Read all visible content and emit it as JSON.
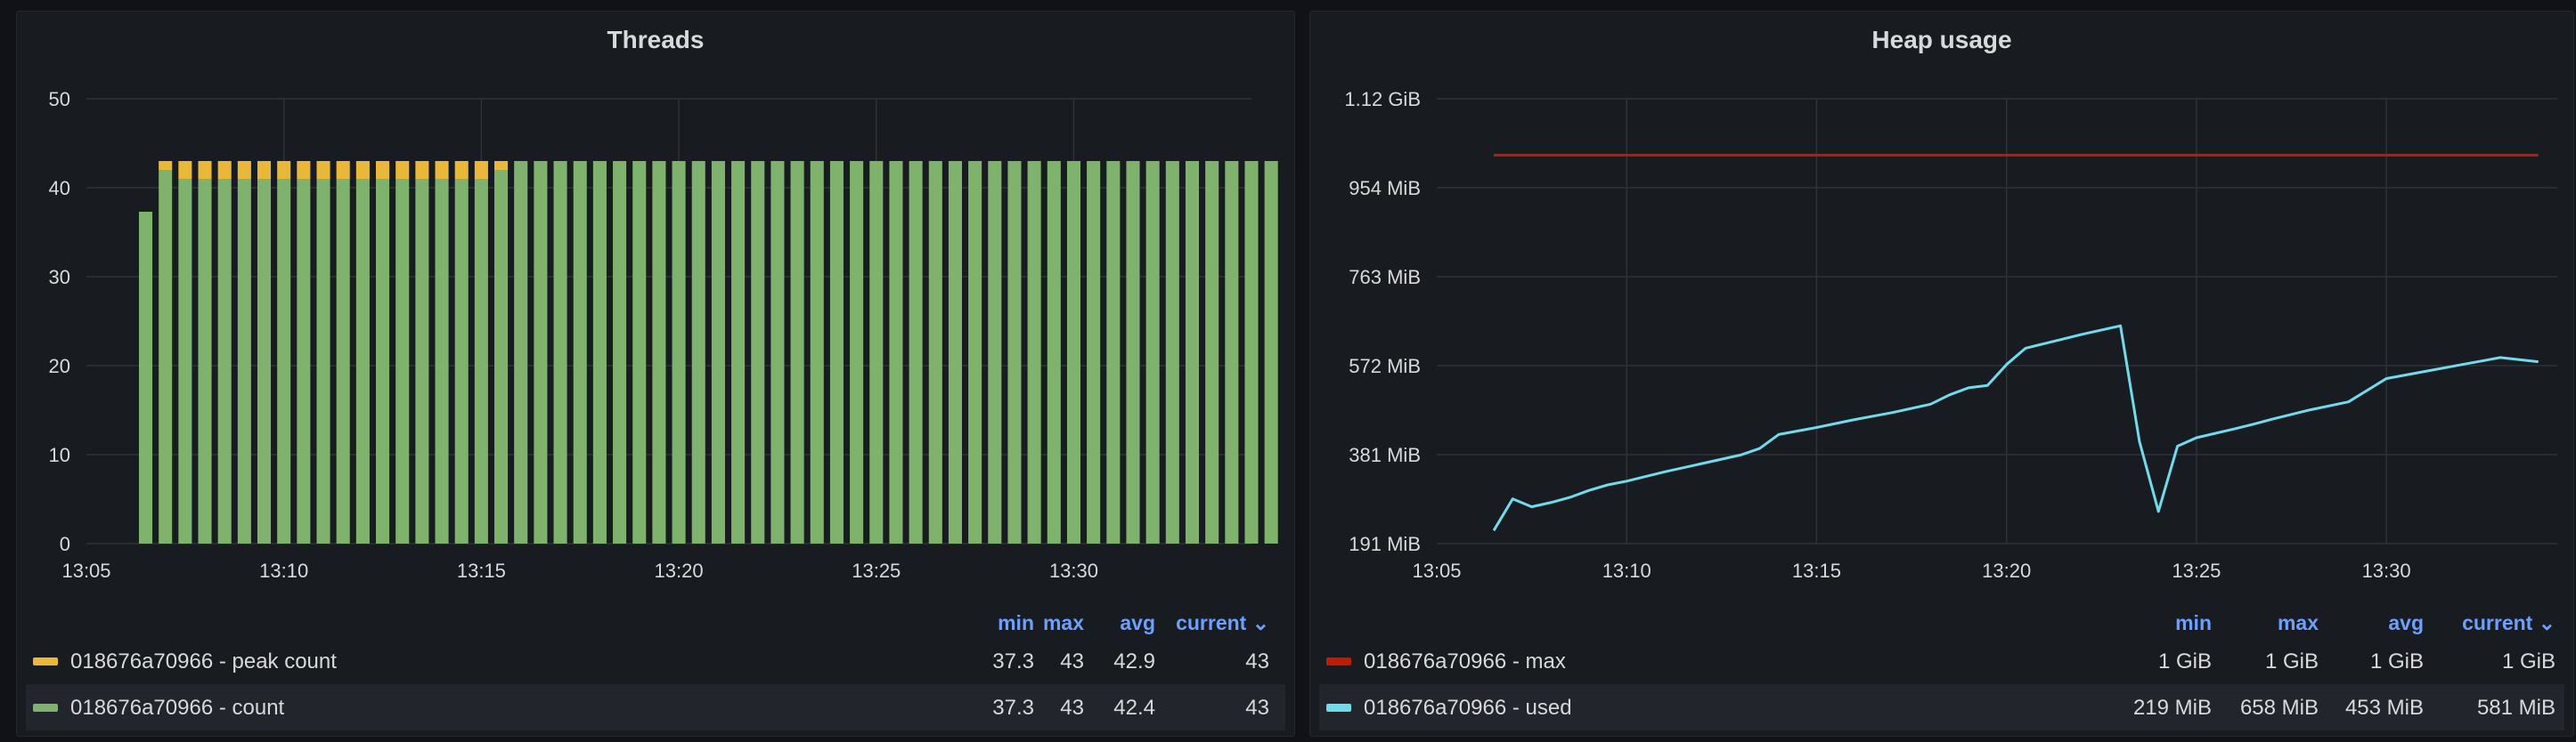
{
  "colors": {
    "peak": "#eab839",
    "count": "#7eb26d",
    "max": "#bf1b00",
    "used": "#70dbed",
    "grid": "#2f3237",
    "tick": "#d8d9da",
    "header": "#6e9fff"
  },
  "panels": [
    {
      "title": "Threads",
      "legend": {
        "headers": {
          "min": "min",
          "max": "max",
          "avg": "avg",
          "current": "current ⌄"
        },
        "rows": [
          {
            "name": "018676a70966 - peak count",
            "min": "37.3",
            "max": "43",
            "avg": "42.9",
            "current": "43",
            "color_key": "peak"
          },
          {
            "name": "018676a70966 - count",
            "min": "37.3",
            "max": "43",
            "avg": "42.4",
            "current": "43",
            "color_key": "count"
          }
        ]
      }
    },
    {
      "title": "Heap usage",
      "legend": {
        "headers": {
          "min": "min",
          "max": "max",
          "avg": "avg",
          "current": "current ⌄"
        },
        "rows": [
          {
            "name": "018676a70966 - max",
            "min": "1 GiB",
            "max": "1 GiB",
            "avg": "1 GiB",
            "current": "1 GiB",
            "color_key": "max"
          },
          {
            "name": "018676a70966 - used",
            "min": "219 MiB",
            "max": "658 MiB",
            "avg": "453 MiB",
            "current": "581 MiB",
            "color_key": "used"
          }
        ]
      }
    }
  ],
  "chart_data": [
    {
      "type": "bar",
      "title": "Threads",
      "stacked": true,
      "x_ticks": [
        "13:05",
        "13:10",
        "13:15",
        "13:20",
        "13:25",
        "13:30"
      ],
      "y_ticks": [
        "0",
        "10",
        "20",
        "30",
        "40",
        "50"
      ],
      "ylim": [
        0,
        50
      ],
      "x_range_minutes": [
        0,
        29.5
      ],
      "grid": true,
      "legend_position": "bottom",
      "bar_start_minute": 1.5,
      "bar_step_minutes": 0.5,
      "series": [
        {
          "name": "018676a70966 - count",
          "color_key": "count",
          "values": [
            37.3,
            42,
            41,
            41,
            41,
            41,
            41,
            41,
            41,
            41,
            41,
            41,
            41,
            41,
            41,
            41,
            41,
            41,
            42,
            43,
            43,
            43,
            43,
            43,
            43,
            43,
            43,
            43,
            43,
            43,
            43,
            43,
            43,
            43,
            43,
            43,
            43,
            43,
            43,
            43,
            43,
            43,
            43,
            43,
            43,
            43,
            43,
            43,
            43,
            43,
            43,
            43,
            43,
            43,
            43,
            43,
            43,
            43
          ]
        },
        {
          "name": "018676a70966 - peak count",
          "color_key": "peak",
          "values": [
            0,
            1,
            2,
            2,
            2,
            2,
            2,
            2,
            2,
            2,
            2,
            2,
            2,
            2,
            2,
            2,
            2,
            2,
            1,
            0,
            0,
            0,
            0,
            0,
            0,
            0,
            0,
            0,
            0,
            0,
            0,
            0,
            0,
            0,
            0,
            0,
            0,
            0,
            0,
            0,
            0,
            0,
            0,
            0,
            0,
            0,
            0,
            0,
            0,
            0,
            0,
            0,
            0,
            0,
            0,
            0,
            0,
            0
          ]
        }
      ]
    },
    {
      "type": "line",
      "title": "Heap usage",
      "x_ticks": [
        "13:05",
        "13:10",
        "13:15",
        "13:20",
        "13:25",
        "13:30"
      ],
      "y_ticks": [
        "191 MiB",
        "381 MiB",
        "572 MiB",
        "763 MiB",
        "954 MiB",
        "1.12 GiB"
      ],
      "ylim_mib": [
        191,
        1145
      ],
      "x_range_minutes": [
        0,
        29.5
      ],
      "grid": true,
      "legend_position": "bottom",
      "series": [
        {
          "name": "018676a70966 - max",
          "color_key": "max",
          "points": [
            [
              1.5,
              1024
            ],
            [
              29.0,
              1024
            ]
          ]
        },
        {
          "name": "018676a70966 - used",
          "color_key": "used",
          "points": [
            [
              1.5,
              219
            ],
            [
              2.0,
              287
            ],
            [
              2.5,
              270
            ],
            [
              3.0,
              279
            ],
            [
              3.5,
              290
            ],
            [
              4.0,
              305
            ],
            [
              4.5,
              317
            ],
            [
              5.0,
              325
            ],
            [
              6.0,
              345
            ],
            [
              7.0,
              363
            ],
            [
              8.0,
              381
            ],
            [
              8.5,
              395
            ],
            [
              9.0,
              425
            ],
            [
              10.0,
              440
            ],
            [
              11.0,
              457
            ],
            [
              12.0,
              472
            ],
            [
              13.0,
              490
            ],
            [
              13.5,
              510
            ],
            [
              14.0,
              525
            ],
            [
              14.5,
              530
            ],
            [
              15.0,
              575
            ],
            [
              15.5,
              610
            ],
            [
              16.0,
              620
            ],
            [
              17.0,
              640
            ],
            [
              18.0,
              658
            ],
            [
              18.5,
              410
            ],
            [
              19.0,
              260
            ],
            [
              19.5,
              400
            ],
            [
              20.0,
              418
            ],
            [
              21.0,
              437
            ],
            [
              21.5,
              447
            ],
            [
              22.0,
              458
            ],
            [
              23.0,
              478
            ],
            [
              24.0,
              495
            ],
            [
              25.0,
              545
            ],
            [
              26.0,
              560
            ],
            [
              27.0,
              575
            ],
            [
              28.0,
              590
            ],
            [
              29.0,
              581
            ]
          ]
        }
      ]
    }
  ]
}
